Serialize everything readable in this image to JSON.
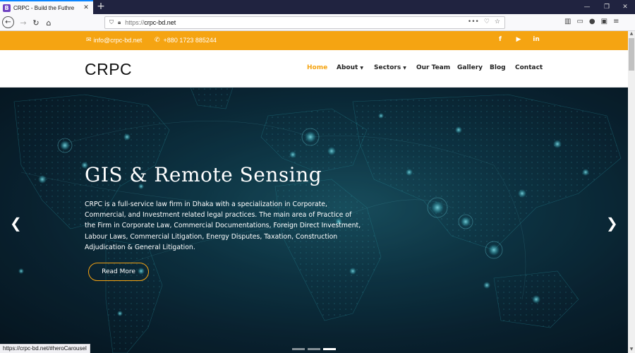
{
  "browser": {
    "tab_title": "CRPC - Build the Futhre",
    "favicon_letter": "B",
    "url_scheme": "https://",
    "url_host": "crpc-bd.net",
    "status_url": "https://crpc-bd.net/#heroCarousel"
  },
  "topbar": {
    "email": "info@crpc-bd.net",
    "phone": "+880 1723 885244",
    "social": [
      "facebook-icon",
      "youtube-icon",
      "linkedin-icon"
    ],
    "accent": "#f5a412"
  },
  "header": {
    "logo": "CRPC",
    "menu": [
      {
        "label": "Home",
        "active": true
      },
      {
        "label": "About",
        "dropdown": true
      },
      {
        "label": "Sectors",
        "dropdown": true
      },
      {
        "label": "Our Team"
      },
      {
        "label": "Gallery"
      },
      {
        "label": "Blog"
      },
      {
        "label": "Contact"
      }
    ]
  },
  "hero": {
    "title": "GIS & Remote Sensing",
    "description": "CRPC is a full-service law firm in Dhaka with a specialization in Corporate, Commercial, and Investment related legal practices. The main area of Practice of the Firm in Corporate Law, Commercial Documentations, Foreign Direct Investment, Labour Laws, Commercial Litigation, Energy Disputes, Taxation, Construction Adjudication & General Litigation.",
    "button_label": "Read More",
    "slides": 3,
    "active_slide": 3
  }
}
